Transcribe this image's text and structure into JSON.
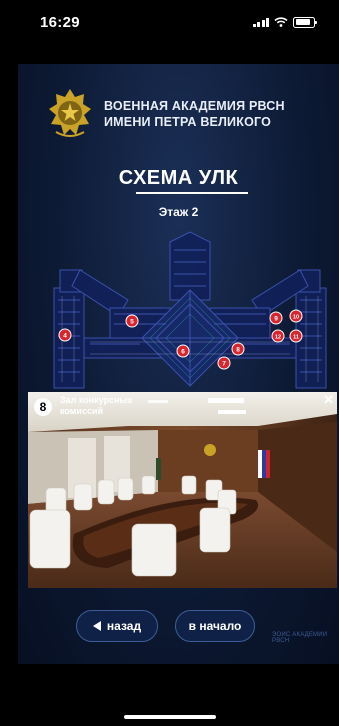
{
  "status": {
    "time": "16:29"
  },
  "header": {
    "line1": "ВОЕННАЯ АКАДЕМИЯ РВСН",
    "line2": "ИМЕНИ ПЕТРА ВЕЛИКОГО"
  },
  "page": {
    "title": "СХЕМА УЛК",
    "floor": "Этаж 2"
  },
  "plan": {
    "markers": [
      "4",
      "5",
      "6",
      "7",
      "8",
      "9",
      "10",
      "11",
      "12"
    ]
  },
  "room": {
    "number": "8",
    "name": "Зал конкурсных комиссий"
  },
  "nav": {
    "back": "назад",
    "home": "в начало"
  },
  "footer": {
    "watermark": "ЭОИС АКАДЕМИИ РВСН"
  },
  "colors": {
    "background": "#0d1a34",
    "marker": "#d8262f",
    "button_border": "#3e5d96"
  }
}
